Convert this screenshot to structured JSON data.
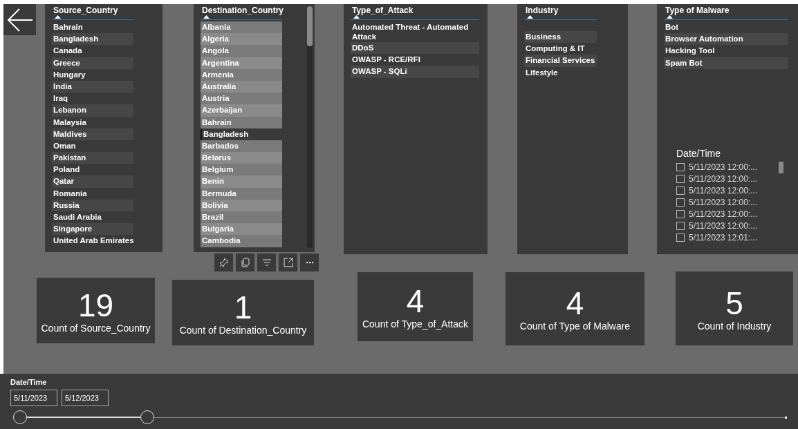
{
  "slicers": [
    {
      "header": "Source_Country",
      "items": [
        "Bahrain",
        "Bangladesh",
        "Canada",
        "Greece",
        "Hungary",
        "India",
        "Iraq",
        "Lebanon",
        "Malaysia",
        "Maldives",
        "Oman",
        "Pakistan",
        "Poland",
        "Qatar",
        "Romania",
        "Russia",
        "Saudi Arabia",
        "Singapore",
        "United Arab Emirates"
      ]
    },
    {
      "header": "Destination_Country",
      "items": [
        {
          "label": "Albania",
          "selected": false
        },
        {
          "label": "Algeria",
          "selected": false
        },
        {
          "label": "Angola",
          "selected": false
        },
        {
          "label": "Argentina",
          "selected": false
        },
        {
          "label": "Armenia",
          "selected": false
        },
        {
          "label": "Australia",
          "selected": false
        },
        {
          "label": "Austria",
          "selected": false
        },
        {
          "label": "Azerbaijan",
          "selected": false
        },
        {
          "label": "Bahrain",
          "selected": false
        },
        {
          "label": "Bangladesh",
          "selected": true
        },
        {
          "label": "Barbados",
          "selected": false
        },
        {
          "label": "Belarus",
          "selected": false
        },
        {
          "label": "Belgium",
          "selected": false
        },
        {
          "label": "Benin",
          "selected": false
        },
        {
          "label": "Bermuda",
          "selected": false
        },
        {
          "label": "Bolivia",
          "selected": false
        },
        {
          "label": "Brazil",
          "selected": false
        },
        {
          "label": "Bulgaria",
          "selected": false
        },
        {
          "label": "Cambodia",
          "selected": false
        }
      ]
    },
    {
      "header": "Type_of_Attack",
      "items": [
        "Automated Threat - Automated Attack",
        "DDoS",
        "OWASP - RCE/RFI",
        "OWASP - SQLi"
      ]
    },
    {
      "header": "Industry",
      "items": [
        "Business",
        "Computing & IT",
        "Financial Services",
        "Lifestyle"
      ]
    },
    {
      "header": "Type of Malware",
      "items": [
        "Bot",
        "Browser Automation",
        "Hacking Tool",
        "Spam Bot"
      ]
    }
  ],
  "date_list": {
    "title": "Date/Time",
    "items": [
      {
        "label": "5/11/2023 12:00:...",
        "checked": false
      },
      {
        "label": "5/11/2023 12:00:...",
        "checked": false
      },
      {
        "label": "5/11/2023 12:00:...",
        "checked": false
      },
      {
        "label": "5/11/2023 12:00:...",
        "checked": false
      },
      {
        "label": "5/11/2023 12:00:...",
        "checked": false
      },
      {
        "label": "5/11/2023 12:00:...",
        "checked": false
      },
      {
        "label": "5/11/2023 12:01:...",
        "checked": false
      }
    ]
  },
  "cards": [
    {
      "value": "19",
      "label": "Count of Source_Country"
    },
    {
      "value": "1",
      "label": "Count of Destination_Country"
    },
    {
      "value": "4",
      "label": "Count of Type_of_Attack"
    },
    {
      "value": "4",
      "label": "Count of Type of Malware"
    },
    {
      "value": "5",
      "label": "Count of Industry"
    }
  ],
  "date_range": {
    "title": "Date/Time",
    "start": "5/11/2023",
    "end": "5/12/2023",
    "thumbs": [
      {
        "level": 0
      },
      {
        "level": 0.166
      }
    ]
  }
}
